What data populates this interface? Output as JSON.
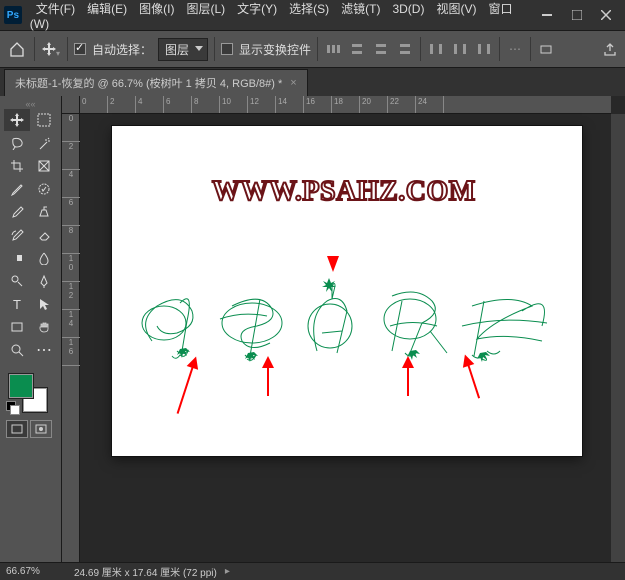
{
  "app": {
    "icon_label": "Ps"
  },
  "menu": [
    "文件(F)",
    "编辑(E)",
    "图像(I)",
    "图层(L)",
    "文字(Y)",
    "选择(S)",
    "滤镜(T)",
    "3D(D)",
    "视图(V)",
    "窗口(W)"
  ],
  "optbar": {
    "auto_select_label": "自动选择：",
    "auto_select_checked": true,
    "dropdown_value": "图层",
    "show_transform_label": "显示变换控件",
    "show_transform_checked": false
  },
  "tab": {
    "title": "未标题-1-恢复的 @ 66.7% (桉树叶 1 拷贝 4, RGB/8#) *"
  },
  "ruler_h": [
    "0",
    "2",
    "4",
    "6",
    "8",
    "10",
    "12",
    "14",
    "16",
    "18",
    "20",
    "22",
    "24"
  ],
  "ruler_v": [
    "0",
    "2",
    "4",
    "6",
    "8",
    "10",
    "12",
    "14",
    "16"
  ],
  "canvas": {
    "watermark": "WWW.PSAHZ.COM",
    "script_letters": "P S A H Z",
    "script_color": "#0a8d4f",
    "arrow_color": "#ff0000"
  },
  "colors": {
    "foreground": "#0a8d4f",
    "background": "#ffffff"
  },
  "status": {
    "zoom": "66.67%",
    "doc_info": "24.69 厘米 x 17.64 厘米 (72 ppi)"
  }
}
